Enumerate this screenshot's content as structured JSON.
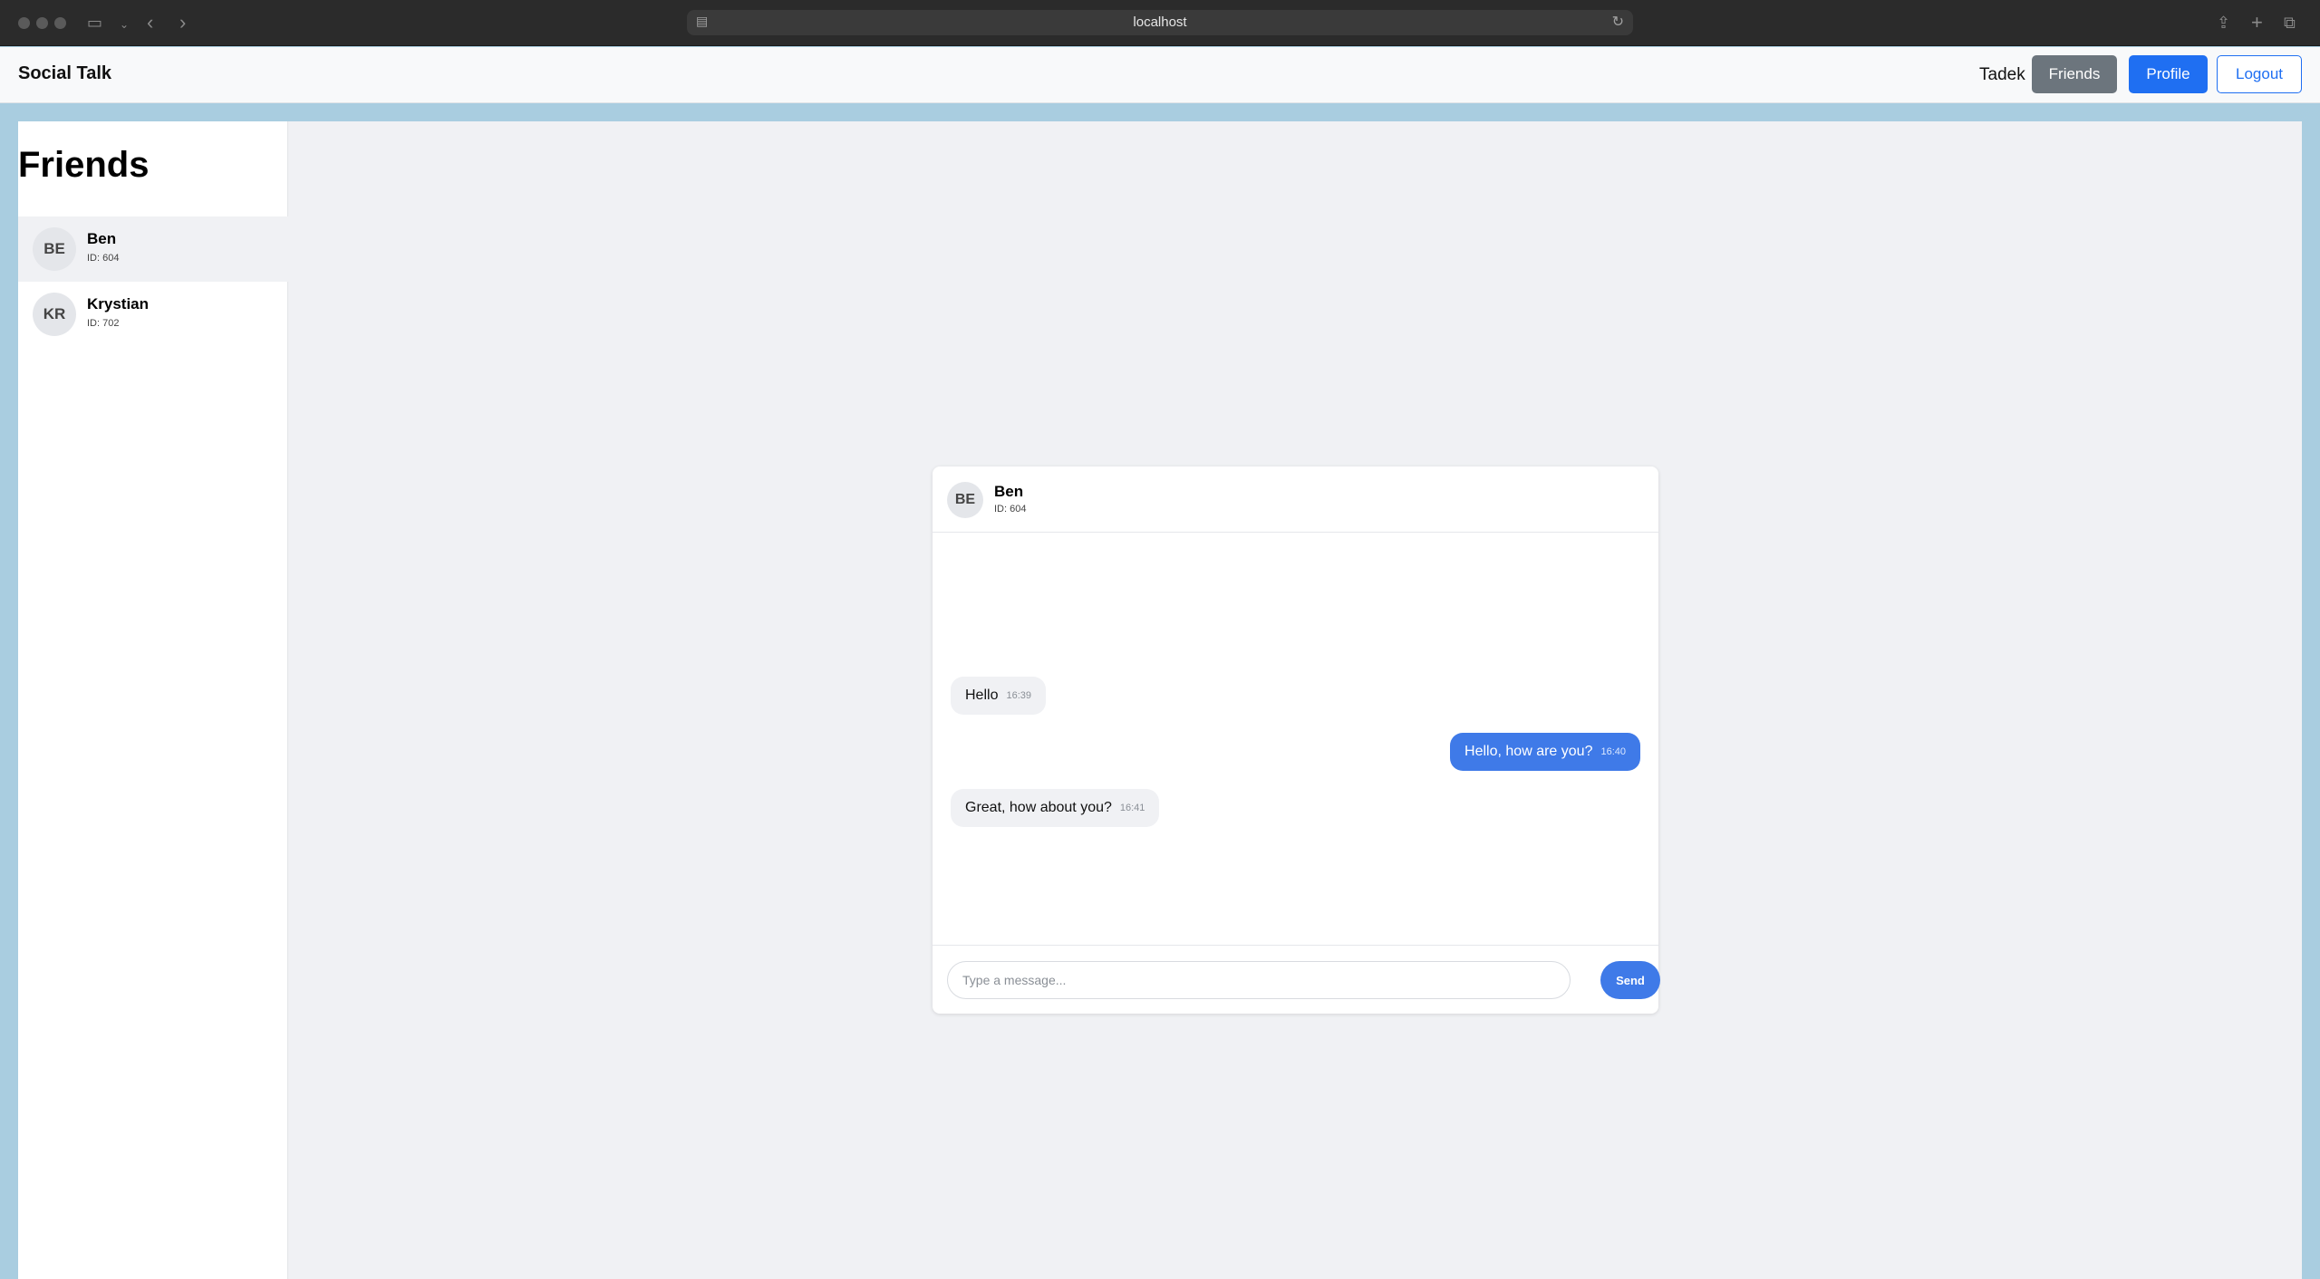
{
  "browser": {
    "url": "localhost"
  },
  "header": {
    "brand": "Social Talk",
    "user_name": "Tadek",
    "friends_label": "Friends",
    "profile_label": "Profile",
    "logout_label": "Logout"
  },
  "sidebar": {
    "title": "Friends",
    "friends": [
      {
        "initials": "BE",
        "name": "Ben",
        "id_label": "ID: 604",
        "active": true
      },
      {
        "initials": "KR",
        "name": "Krystian",
        "id_label": "ID: 702",
        "active": false
      }
    ]
  },
  "chat": {
    "contact": {
      "initials": "BE",
      "name": "Ben",
      "id_label": "ID: 604"
    },
    "messages": [
      {
        "direction": "in",
        "text": "Hello",
        "time": "16:39"
      },
      {
        "direction": "out",
        "text": "Hello, how are you?",
        "time": "16:40"
      },
      {
        "direction": "in",
        "text": "Great, how about you?",
        "time": "16:41"
      }
    ],
    "input": {
      "value": "",
      "placeholder": "Type a message..."
    },
    "send_label": "Send"
  },
  "colors": {
    "accent": "#1f6ff2",
    "message_out": "#3f7ae8",
    "frame": "#a9cde0"
  }
}
